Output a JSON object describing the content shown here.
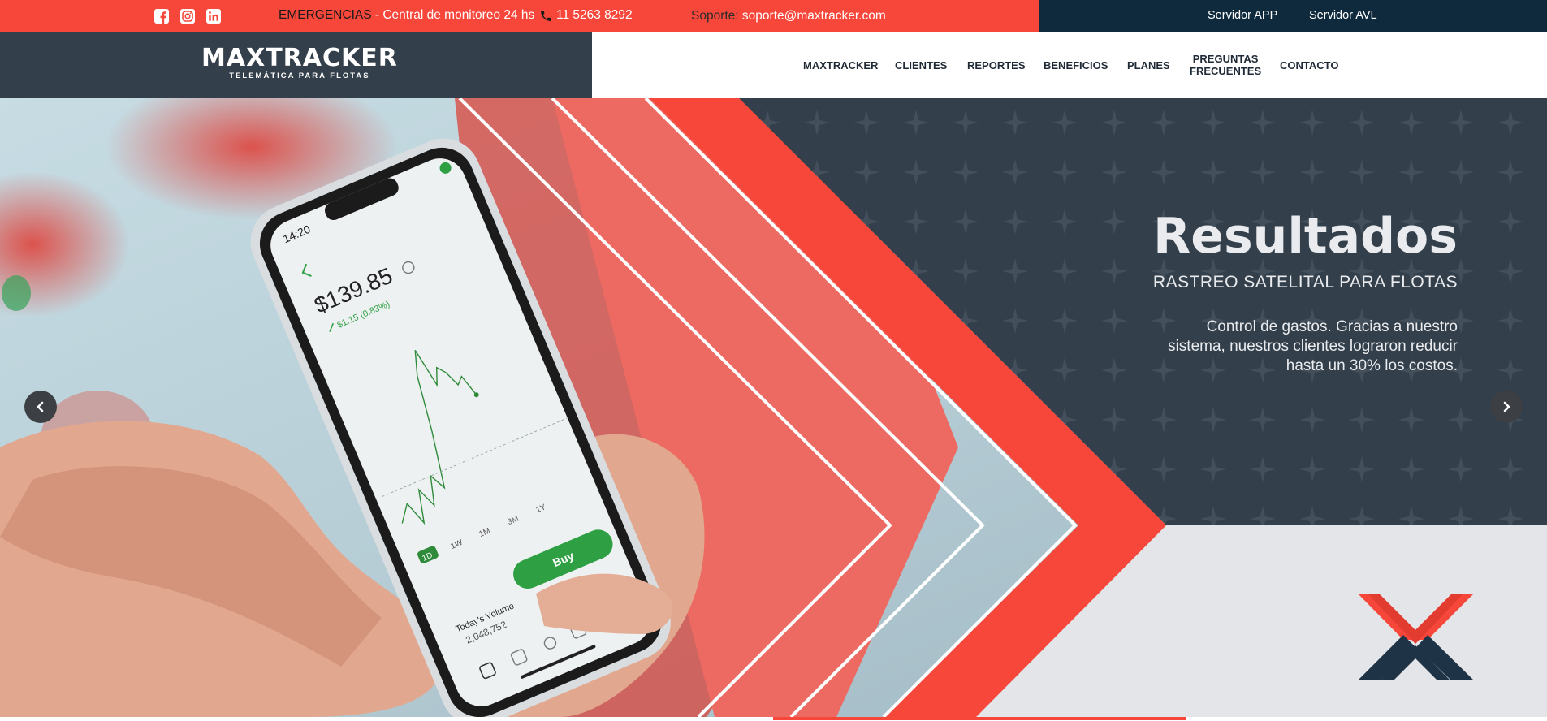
{
  "topbar": {
    "emergency_label": "EMERGENCIAS",
    "emergency_rest": " - Central de monitoreo 24 hs",
    "phone": "11 5263 8292",
    "support_label": "Soporte:",
    "support_email": "soporte@maxtracker.com",
    "server_app": "Servidor APP",
    "server_avl": "Servidor AVL",
    "social": [
      "facebook-icon",
      "instagram-icon",
      "linkedin-icon"
    ]
  },
  "brand": {
    "name": "MAXTRACKER",
    "tagline": "TELEMÁTICA PARA FLOTAS"
  },
  "nav": {
    "items": [
      {
        "label": "MAXTRACKER"
      },
      {
        "label": "CLIENTES"
      },
      {
        "label": "REPORTES"
      },
      {
        "label": "BENEFICIOS"
      },
      {
        "label": "PLANES"
      },
      {
        "label_line1": "PREGUNTAS",
        "label_line2": "FRECUENTES"
      },
      {
        "label": "CONTACTO"
      }
    ]
  },
  "hero": {
    "title": "Resultados",
    "subtitle": "RASTREO SATELITAL PARA FLOTAS",
    "text": "Control de gastos. Gracias a nuestro sistema, nuestros clientes lograron reducir hasta un 30% los costos.",
    "phone_screen": {
      "time": "14:20",
      "price": "$139.85",
      "change": "$1.15 (0.83%)",
      "periods": [
        "1D",
        "1W",
        "1M",
        "3M",
        "1Y"
      ],
      "buy": "Buy",
      "volume_label": "Today's Volume",
      "volume_value": "2,048,752"
    }
  },
  "colors": {
    "accent_red": "#f7473b",
    "dark_navy": "#0f2a3c",
    "slate": "#333f4a"
  }
}
